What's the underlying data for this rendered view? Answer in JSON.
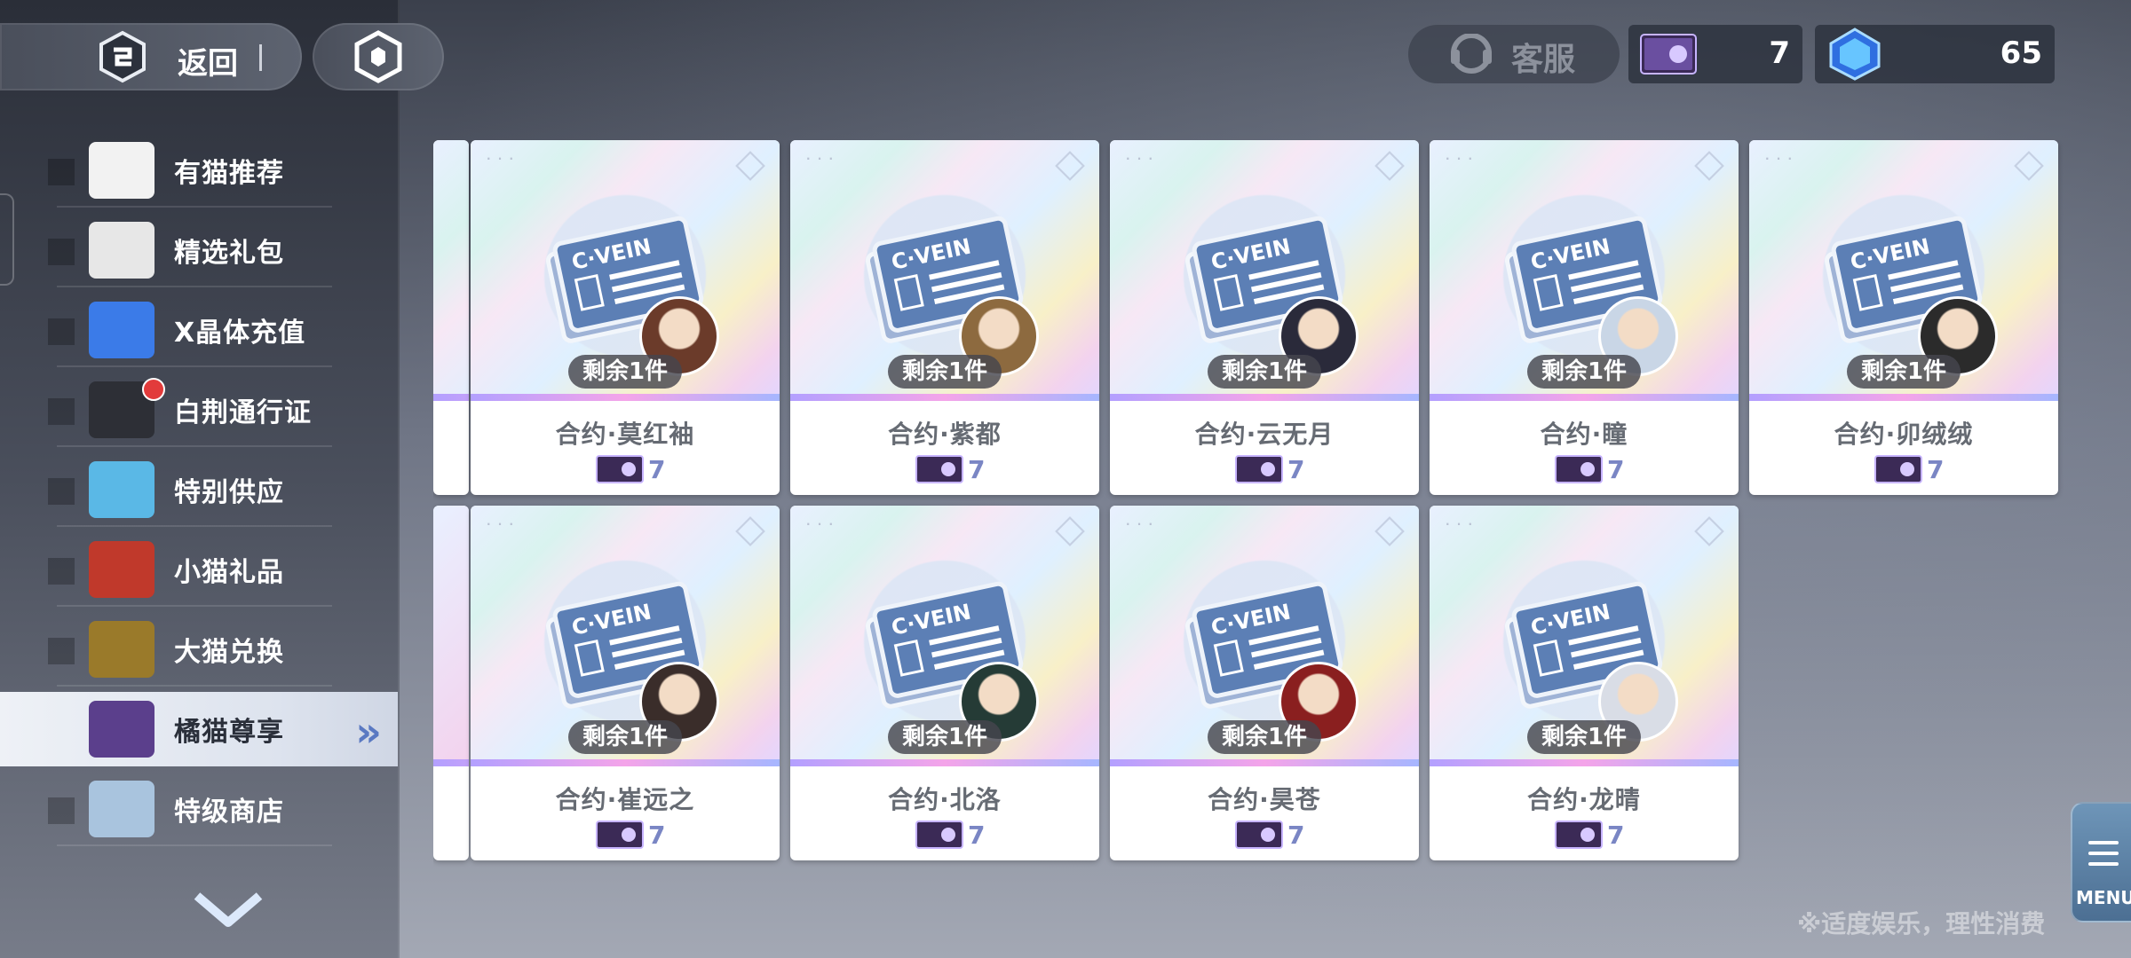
{
  "header": {
    "back_label": "返回",
    "service_label": "客服",
    "currencies": [
      {
        "icon": "orange-cat-card-icon",
        "value": "7"
      },
      {
        "icon": "x-crystal-icon",
        "value": "65"
      }
    ]
  },
  "sidebar": {
    "items": [
      {
        "label": "有猫推荐",
        "icon": "cat-cup-icon",
        "active": false
      },
      {
        "label": "精选礼包",
        "icon": "free-gift-box-icon",
        "active": false
      },
      {
        "label": "X晶体充值",
        "icon": "x-crystal-icon",
        "active": false
      },
      {
        "label": "白荆通行证",
        "icon": "pass-card-icon",
        "active": false,
        "badge": "timer"
      },
      {
        "label": "特别供应",
        "icon": "energy-capsule-icon",
        "active": false
      },
      {
        "label": "小猫礼品",
        "icon": "gift-card-icon",
        "active": false
      },
      {
        "label": "大猫兑换",
        "icon": "gold-card-icon",
        "active": false
      },
      {
        "label": "橘猫尊享",
        "icon": "orange-cat-card-icon",
        "active": true
      },
      {
        "label": "特级商店",
        "icon": "premium-shop-icon",
        "active": false
      }
    ]
  },
  "shop": {
    "items": [
      {
        "name": "合约·莫红袖",
        "remaining": "剩余1件",
        "price": "7"
      },
      {
        "name": "合约·紫都",
        "remaining": "剩余1件",
        "price": "7"
      },
      {
        "name": "合约·云无月",
        "remaining": "剩余1件",
        "price": "7"
      },
      {
        "name": "合约·瞳",
        "remaining": "剩余1件",
        "price": "7"
      },
      {
        "name": "合约·卯绒绒",
        "remaining": "剩余1件",
        "price": "7"
      },
      {
        "name": "合约·崔远之",
        "remaining": "剩余1件",
        "price": "7"
      },
      {
        "name": "合约·北洛",
        "remaining": "剩余1件",
        "price": "7"
      },
      {
        "name": "合约·昊苍",
        "remaining": "剩余1件",
        "price": "7"
      },
      {
        "name": "合约·龙晴",
        "remaining": "剩余1件",
        "price": "7"
      }
    ]
  },
  "footer": {
    "notice": "※适度娱乐，理性消费",
    "menu_label": "MENU"
  }
}
